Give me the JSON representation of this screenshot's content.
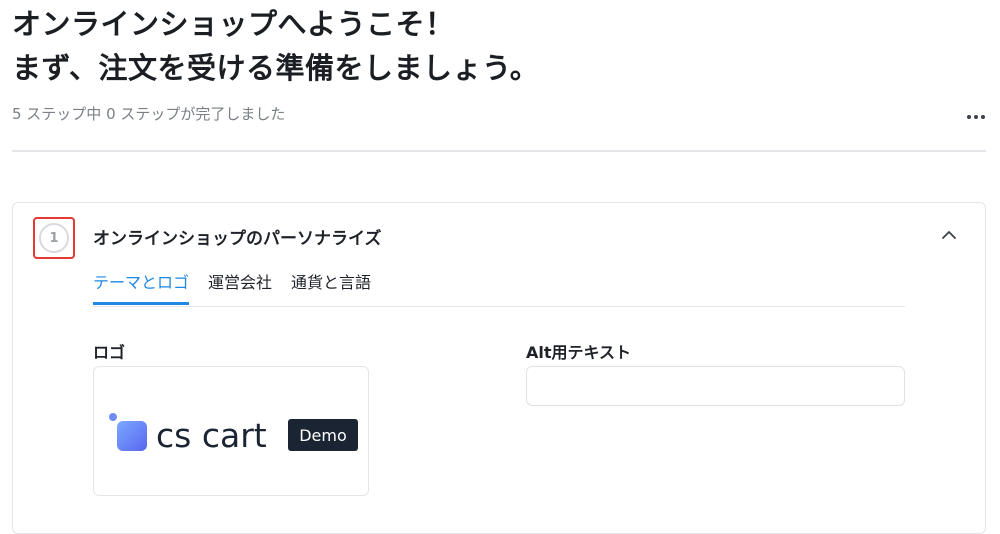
{
  "header": {
    "title_line1": "オンラインショップへようこそ！",
    "title_line2": "まず、注文を受ける準備をしましょう。",
    "progress_text": "5 ステップ中 0 ステップが完了しました",
    "more_icon": "ellipsis-icon"
  },
  "step": {
    "number": "1",
    "title": "オンラインショップのパーソナライズ",
    "collapse_icon": "chevron-up-icon",
    "tabs": [
      {
        "label": "テーマとロゴ",
        "active": true
      },
      {
        "label": "運営会社",
        "active": false
      },
      {
        "label": "通貨と言語",
        "active": false
      }
    ],
    "logo_label": "ロゴ",
    "logo_text": "cs cart",
    "logo_badge": "Demo",
    "alt_label": "Alt用テキスト",
    "alt_value": ""
  },
  "colors": {
    "accent": "#1e88e5",
    "highlight": "#e53935",
    "logo_gradient_start": "#7aa8ff",
    "logo_gradient_end": "#5a66f0",
    "badge_bg": "#1b2433"
  }
}
